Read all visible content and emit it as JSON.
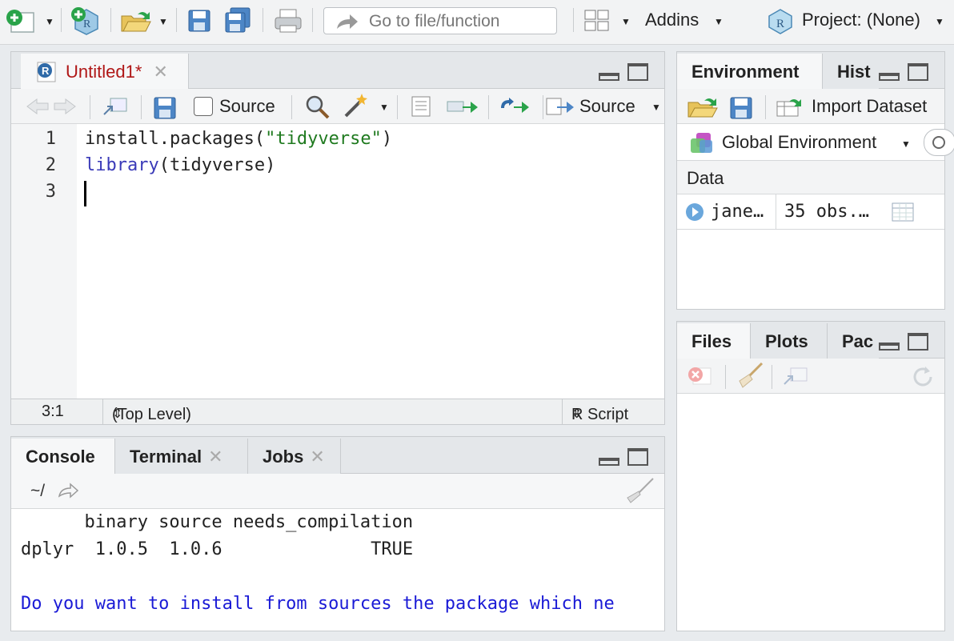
{
  "toolbar": {
    "goto_placeholder": "Go to file/function",
    "addins_label": "Addins",
    "project_label": "Project: (None)"
  },
  "editor": {
    "tab_title": "Untitled1*",
    "source_checkbox_label": "Source",
    "source_button_label": "Source",
    "lines": [
      {
        "num": "1"
      },
      {
        "num": "2"
      },
      {
        "num": "3"
      }
    ],
    "line1": {
      "pre": "install.packages(",
      "str": "\"tidyverse\"",
      "post": ")"
    },
    "line2": {
      "fn": "library",
      "post": "(tidyverse)"
    },
    "status": {
      "position": "3:1",
      "scope": "(Top Level)",
      "filetype": "R Script"
    }
  },
  "console": {
    "tabs": [
      "Console",
      "Terminal",
      "Jobs"
    ],
    "path": "~/",
    "output": [
      "      binary source needs_compilation",
      "dplyr  1.0.5  1.0.6              TRUE",
      "",
      "Do you want to install from sources the package which ne"
    ]
  },
  "environment": {
    "tabs": [
      "Environment",
      "Hist"
    ],
    "import_label": "Import Dataset",
    "scope_label": "Global Environment",
    "section_header": "Data",
    "rows": [
      {
        "name": "jane…",
        "value": "35 obs.…"
      }
    ]
  },
  "files": {
    "tabs": [
      "Files",
      "Plots",
      "Pac"
    ]
  },
  "colors": {
    "accent_red": "#b01717",
    "string_green": "#1f7a1f",
    "keyword_blue": "#3a3ab8",
    "console_blue": "#1a1ad6"
  }
}
